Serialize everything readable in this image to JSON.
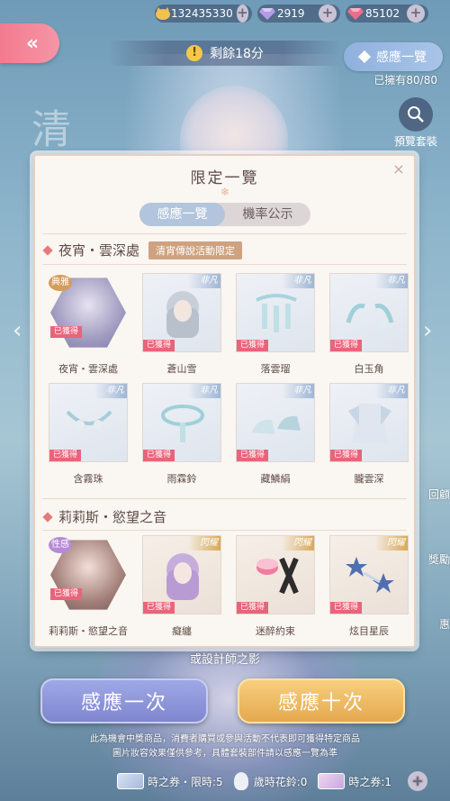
{
  "header": {
    "currencies": [
      {
        "icon": "gold-cat-coin-icon",
        "value": "132435330"
      },
      {
        "icon": "purple-diamond-icon",
        "value": "2919"
      },
      {
        "icon": "pink-diamond-icon",
        "value": "85102"
      }
    ],
    "plus": "+",
    "back_label": "«",
    "timer_icon": "!",
    "timer_text": "剩餘18分",
    "induce_label": "感應一覽",
    "owned_text": "已擁有80/80",
    "preview_label": "預覽套裝"
  },
  "side_labels": [
    "回顧",
    "獎勵",
    "惠"
  ],
  "background_calligraphy": "清",
  "modal": {
    "title": "限定一覽",
    "deco": "❄",
    "close": "×",
    "tabs": [
      {
        "label": "感應一覽",
        "active": true
      },
      {
        "label": "機率公示",
        "active": false
      }
    ],
    "sections": [
      {
        "title": "夜宵・雲深處",
        "tag": "清宵傳說活動限定",
        "items": [
          {
            "name": "夜宵・雲深處",
            "rank": "典雅",
            "status": "已獲得",
            "kind": "suit"
          },
          {
            "name": "蒼山雪",
            "rank": "非凡",
            "status": "已獲得",
            "kind": "hair"
          },
          {
            "name": "落雲瑠",
            "rank": "非凡",
            "status": "已獲得",
            "kind": "accessory"
          },
          {
            "name": "白玉角",
            "rank": "非凡",
            "status": "已獲得",
            "kind": "horn"
          },
          {
            "name": "含霧珠",
            "rank": "非凡",
            "status": "已獲得",
            "kind": "pearl"
          },
          {
            "name": "雨霖鈴",
            "rank": "非凡",
            "status": "已獲得",
            "kind": "choker"
          },
          {
            "name": "藏鱗絹",
            "rank": "非凡",
            "status": "已獲得",
            "kind": "shoes"
          },
          {
            "name": "朧雲深",
            "rank": "非凡",
            "status": "已獲得",
            "kind": "dress"
          }
        ]
      },
      {
        "title": "莉莉斯・慾望之音",
        "items": [
          {
            "name": "莉莉斯・慾望之音",
            "rank": "性感",
            "status": "已獲得",
            "kind": "suit"
          },
          {
            "name": "癡纏",
            "rank": "閃耀",
            "status": "已獲得",
            "kind": "hair"
          },
          {
            "name": "迷醉約束",
            "rank": "閃耀",
            "status": "已獲得",
            "kind": "bracelet"
          },
          {
            "name": "炫目星辰",
            "rank": "閃耀",
            "status": "已獲得",
            "kind": "earrings"
          }
        ]
      }
    ]
  },
  "under_text": "或設計師之影",
  "buttons": {
    "one": "感應一次",
    "ten": "感應十次"
  },
  "notice_lines": [
    "此為機會中獎商品，消費者購買或參與活動不代表即可獲得特定商品",
    "圖片妝容效果僅供參考，具體套裝部件請以感應一覽為準"
  ],
  "footer": {
    "items": [
      {
        "label": "時之券・限時:5"
      },
      {
        "label": "歲時花鈴:0"
      },
      {
        "label": "時之券:1"
      }
    ]
  },
  "colors": {
    "modal_bg": "#faf6f2",
    "acquired_badge": "#e9647a",
    "tab_active": "#b3c5dc",
    "button_one": "#8f97dc",
    "button_ten": "#eebc62",
    "back_button": "#f37a8f"
  }
}
